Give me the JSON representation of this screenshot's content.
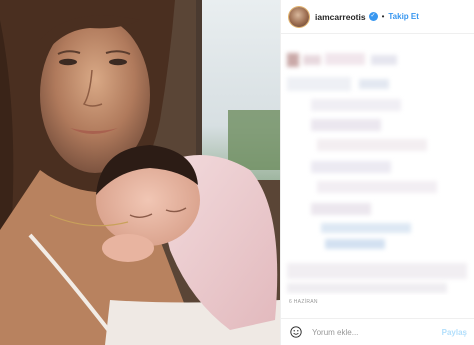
{
  "post": {
    "username": "iamcarreotis",
    "verified_icon": "check-icon",
    "separator": "•",
    "follow_label": "Takip Et",
    "date": "6 HAZİRAN"
  },
  "comment": {
    "placeholder": "Yorum ekle...",
    "share_label": "Paylaş"
  },
  "colors": {
    "accent_blue": "#3897f0",
    "disabled_blue": "#b2dffc",
    "text_dark": "#262626",
    "text_muted": "#999999",
    "border": "#efefef"
  }
}
